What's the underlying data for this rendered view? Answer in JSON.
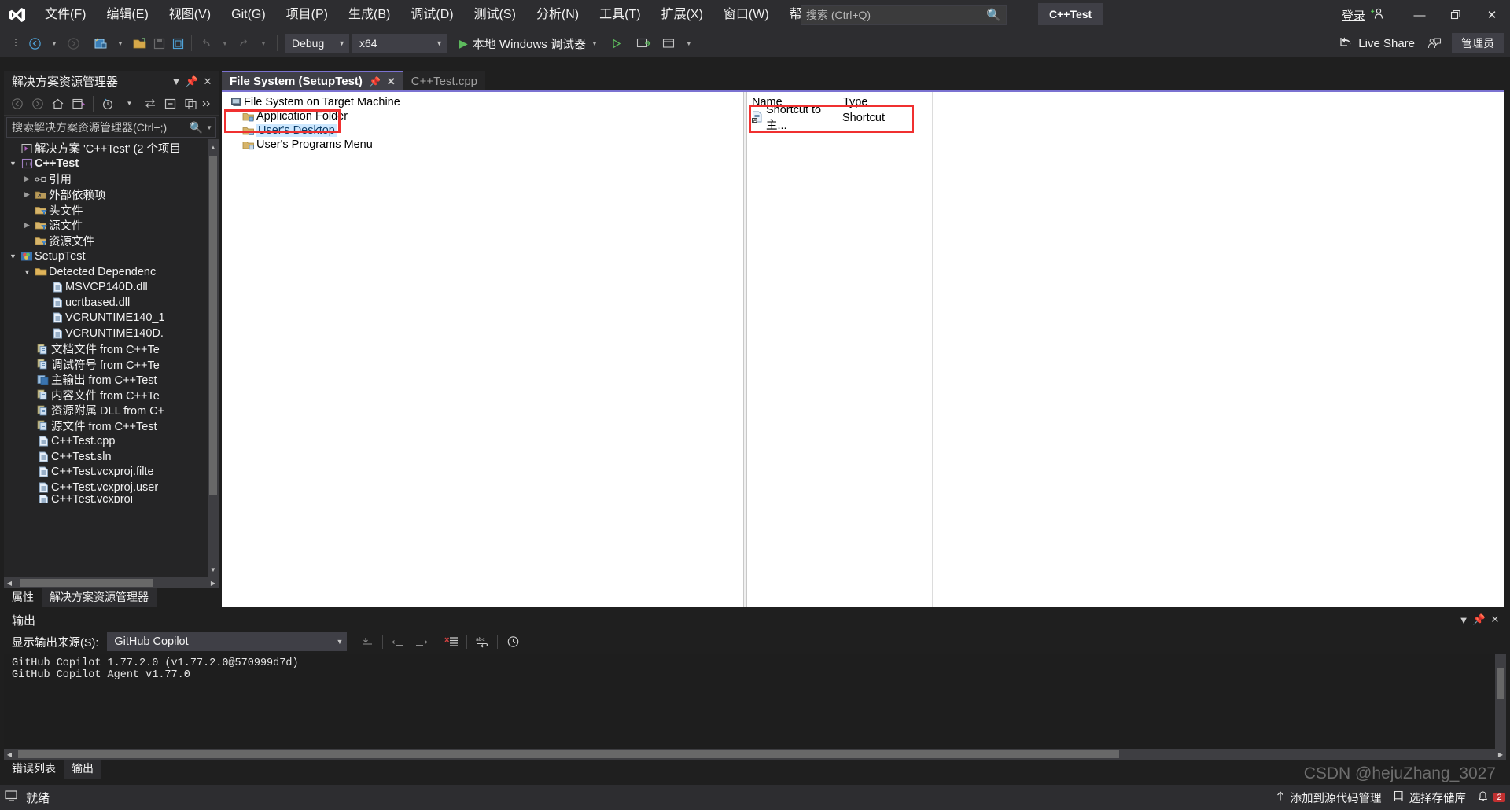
{
  "titlebar": {
    "logo_icon": "visual-studio-logo-icon",
    "menus": [
      {
        "label": "文件(F)"
      },
      {
        "label": "编辑(E)"
      },
      {
        "label": "视图(V)"
      },
      {
        "label": "Git(G)"
      },
      {
        "label": "项目(P)"
      },
      {
        "label": "生成(B)"
      },
      {
        "label": "调试(D)"
      },
      {
        "label": "测试(S)"
      },
      {
        "label": "分析(N)"
      },
      {
        "label": "工具(T)"
      },
      {
        "label": "扩展(X)"
      },
      {
        "label": "窗口(W)"
      },
      {
        "label": "帮助(H)"
      }
    ],
    "search_placeholder": "搜索 (Ctrl+Q)",
    "search_icon": "magnifier-icon",
    "solution_chip": "C++Test",
    "signin_label": "登录",
    "signin_icon": "add-account-icon",
    "minimize_icon": "minimize-icon",
    "restore_icon": "restore-icon",
    "close_icon": "close-icon"
  },
  "toolbar": {
    "back_icon": "navigate-back-icon",
    "forward_icon": "navigate-forward-icon",
    "new_project_icon": "new-project-icon",
    "open_icon": "open-file-icon",
    "save_icon": "save-icon",
    "save_all_icon": "save-all-icon",
    "undo_icon": "undo-icon",
    "redo_icon": "redo-icon",
    "config_value": "Debug",
    "platform_value": "x64",
    "run_label": "本地 Windows 调试器",
    "run_icon": "play-icon",
    "start_noDebug_icon": "play-outline-icon",
    "attach_icon": "attach-process-icon",
    "window_layout_icon": "window-layout-icon",
    "live_share_label": "Live Share",
    "live_share_icon": "share-icon",
    "feedback_icon": "feedback-icon",
    "admin_label": "管理员"
  },
  "solution_explorer": {
    "title": "解决方案资源管理器",
    "dropdown_icon": "chevron-down-icon",
    "pin_icon": "pin-icon",
    "close_icon": "close-icon",
    "toolbar_icons": [
      "back-icon",
      "forward-icon",
      "home-icon",
      "solution-view-icon",
      "pending-changes-icon",
      "chevron-down-icon",
      "sync-icon",
      "collapse-all-icon",
      "properties-icon",
      "overflow-icon"
    ],
    "search_placeholder": "搜索解决方案资源管理器(Ctrl+;)",
    "search_icon": "magnifier-icon",
    "search_dropdown_icon": "chevron-down-icon",
    "tree": [
      {
        "label": "解决方案 'C++Test' (2 个项目",
        "indent": 0,
        "arrow": "",
        "icon": "solution-icon",
        "bold": false,
        "selected": false
      },
      {
        "label": "C++Test",
        "indent": 1,
        "arrow": "open",
        "icon": "cpp-project-icon",
        "bold": true,
        "selected": false
      },
      {
        "label": "引用",
        "indent": 2,
        "arrow": "closed",
        "icon": "references-icon",
        "bold": false,
        "selected": false
      },
      {
        "label": "外部依赖项",
        "indent": 2,
        "arrow": "closed",
        "icon": "ext-dep-icon",
        "bold": false,
        "selected": false
      },
      {
        "label": "头文件",
        "indent": 3,
        "arrow": "",
        "icon": "filter-folder-icon",
        "bold": false,
        "selected": false
      },
      {
        "label": "源文件",
        "indent": 2,
        "arrow": "closed",
        "icon": "filter-folder-icon",
        "bold": false,
        "selected": false
      },
      {
        "label": "资源文件",
        "indent": 3,
        "arrow": "",
        "icon": "filter-folder-icon",
        "bold": false,
        "selected": false
      },
      {
        "label": "SetupTest",
        "indent": 1,
        "arrow": "open",
        "icon": "setup-project-icon",
        "bold": false,
        "selected": false
      },
      {
        "label": "Detected Dependenc",
        "indent": 2,
        "arrow": "open",
        "icon": "folder-open-icon",
        "bold": false,
        "selected": false
      },
      {
        "label": "MSVCP140D.dll",
        "indent": 4,
        "arrow": "",
        "icon": "file-icon",
        "bold": false,
        "selected": false
      },
      {
        "label": "ucrtbased.dll",
        "indent": 4,
        "arrow": "",
        "icon": "file-icon",
        "bold": false,
        "selected": false
      },
      {
        "label": "VCRUNTIME140_1",
        "indent": 4,
        "arrow": "",
        "icon": "file-icon",
        "bold": false,
        "selected": false
      },
      {
        "label": "VCRUNTIME140D.",
        "indent": 4,
        "arrow": "",
        "icon": "file-icon",
        "bold": false,
        "selected": false
      },
      {
        "label": "文档文件 from C++Te",
        "indent": 3,
        "arrow": "",
        "icon": "output-group-icon",
        "bold": false,
        "selected": false
      },
      {
        "label": "调试符号 from C++Te",
        "indent": 3,
        "arrow": "",
        "icon": "output-group-icon",
        "bold": false,
        "selected": false
      },
      {
        "label": "主输出 from C++Test",
        "indent": 3,
        "arrow": "",
        "icon": "primary-output-icon",
        "bold": false,
        "selected": false
      },
      {
        "label": "内容文件 from C++Te",
        "indent": 3,
        "arrow": "",
        "icon": "output-group-icon",
        "bold": false,
        "selected": false
      },
      {
        "label": "资源附属 DLL from C+",
        "indent": 3,
        "arrow": "",
        "icon": "output-group-icon",
        "bold": false,
        "selected": false
      },
      {
        "label": "源文件 from C++Test",
        "indent": 3,
        "arrow": "",
        "icon": "output-group-icon",
        "bold": false,
        "selected": false
      },
      {
        "label": "C++Test.cpp",
        "indent": 3,
        "arrow": "",
        "icon": "file-icon",
        "bold": false,
        "selected": false
      },
      {
        "label": "C++Test.sln",
        "indent": 3,
        "arrow": "",
        "icon": "file-icon",
        "bold": false,
        "selected": false
      },
      {
        "label": "C++Test.vcxproj.filte",
        "indent": 3,
        "arrow": "",
        "icon": "file-icon",
        "bold": false,
        "selected": false
      },
      {
        "label": "C++Test.vcxproj.user",
        "indent": 3,
        "arrow": "",
        "icon": "file-icon",
        "bold": false,
        "selected": false
      },
      {
        "label": "C++Test.vcxproj",
        "indent": 3,
        "arrow": "",
        "icon": "file-icon",
        "bold": false,
        "selected": false
      }
    ],
    "bottom_tabs": [
      {
        "label": "属性",
        "active": false
      },
      {
        "label": "解决方案资源管理器",
        "active": true
      }
    ]
  },
  "editor": {
    "tabs": [
      {
        "label": "File System (SetupTest)",
        "active": true,
        "pin_icon": "pin-icon",
        "close_icon": "close-icon"
      },
      {
        "label": "C++Test.cpp",
        "active": false
      }
    ],
    "file_system": {
      "tree": [
        {
          "label": "File System on Target Machine",
          "indent": 0,
          "icon": "computer-icon",
          "selected": false
        },
        {
          "label": "Application Folder",
          "indent": 1,
          "icon": "folder-app-icon",
          "selected": false
        },
        {
          "label": "User's Desktop",
          "indent": 1,
          "icon": "folder-desktop-icon",
          "selected": true
        },
        {
          "label": "User's Programs Menu",
          "indent": 1,
          "icon": "folder-programs-icon",
          "selected": false
        }
      ],
      "columns": [
        "Name",
        "Type"
      ],
      "items": [
        {
          "name": "Shortcut to 主...",
          "type": "Shortcut",
          "icon": "shortcut-icon"
        }
      ]
    },
    "highlight_color": "#f03030"
  },
  "output": {
    "title": "输出",
    "dropdown_icon": "chevron-down-icon",
    "pin_icon": "pin-icon",
    "close_icon": "close-icon",
    "source_label": "显示输出来源(S):",
    "source_value": "GitHub Copilot",
    "source_caret_icon": "chevron-down-icon",
    "toolbar_icons": [
      "go-to-message-icon",
      "previous-message-icon",
      "next-message-icon",
      "clear-all-icon",
      "word-wrap-icon",
      "history-icon"
    ],
    "lines": [
      "GitHub Copilot 1.77.2.0 (v1.77.2.0@570999d7d)",
      "GitHub Copilot Agent v1.77.0"
    ],
    "bottom_tabs": [
      {
        "label": "错误列表",
        "active": false
      },
      {
        "label": "输出",
        "active": true
      }
    ]
  },
  "status_bar": {
    "ready_label": "就绪",
    "ready_icon": "ready-icon",
    "source_control_label": "添加到源代码管理",
    "source_control_icon": "upload-icon",
    "select_repo_label": "选择存储库",
    "select_repo_icon": "repo-icon",
    "notification_count": "2",
    "notification_icon": "bell-icon"
  },
  "watermark": "CSDN @hejuZhang_3027"
}
